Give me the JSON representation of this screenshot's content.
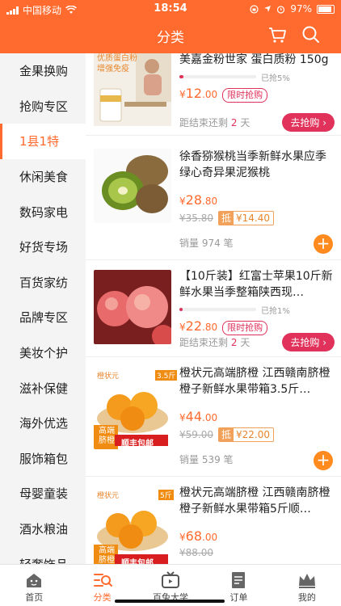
{
  "status_bar": {
    "carrier": "中国移动",
    "time": "18:54",
    "battery": "97%"
  },
  "header": {
    "title": "分类",
    "icons": [
      "cart-icon",
      "search-icon"
    ]
  },
  "sidebar": {
    "items": [
      {
        "label": "金果换购"
      },
      {
        "label": "抢购专区"
      },
      {
        "label": "1县1特",
        "active": true
      },
      {
        "label": "休闲美食"
      },
      {
        "label": "数码家电"
      },
      {
        "label": "好货专场"
      },
      {
        "label": "百货家纺"
      },
      {
        "label": "品牌专区"
      },
      {
        "label": "美妆个护"
      },
      {
        "label": "滋补保健"
      },
      {
        "label": "海外优选"
      },
      {
        "label": "服饰箱包"
      },
      {
        "label": "母婴童装"
      },
      {
        "label": "酒水粮油"
      },
      {
        "label": "轻奢饰品"
      }
    ]
  },
  "products": [
    {
      "name": "美嘉金粉世家 蛋白质粉 150g",
      "type": "flash",
      "progress_label": "已抢5%",
      "progress": 0.05,
      "price_symbol": "¥",
      "price_int": "12",
      "price_dec": ".00",
      "tag": "限时抢购",
      "countdown_prefix": "距结束还剩",
      "countdown_days": "2",
      "countdown_unit": "天",
      "button": "去抢购",
      "image_text": {
        "line1": "优质蛋白粉",
        "line2": "增强免疫"
      }
    },
    {
      "name": "徐香猕猴桃当季新鲜水果应季绿心奇异果泥猴桃",
      "type": "normal",
      "price_symbol": "¥",
      "price_int": "28",
      "price_dec": ".80",
      "original_price": "¥35.80",
      "offset_label": "抵",
      "offset_value": "¥14.40",
      "sales": "销量 974 笔"
    },
    {
      "name": "【10斤装】红富士苹果10斤新鲜水果当季整箱陕西现…",
      "type": "flash",
      "progress_label": "已抢1%",
      "progress": 0.01,
      "price_symbol": "¥",
      "price_int": "22",
      "price_dec": ".80",
      "tag": "限时抢购",
      "countdown_prefix": "距结束还剩",
      "countdown_days": "2",
      "countdown_unit": "天",
      "button": "去抢购"
    },
    {
      "name": "橙状元高端脐橙 江西赣南脐橙橙子新鲜水果带箱3.5斤…",
      "type": "normal",
      "price_symbol": "¥",
      "price_int": "44",
      "price_dec": ".00",
      "original_price": "¥59.00",
      "offset_label": "抵",
      "offset_value": "¥22.00",
      "sales": "销量 539 笔",
      "image_text": {
        "brand": "橙状元",
        "weight": "3.5斤",
        "line1": "高端",
        "line2": "脐橙",
        "banner": "顺丰包邮"
      }
    },
    {
      "name": "橙状元高端脐橙 江西赣南脐橙橙子新鲜水果带箱5斤顺…",
      "type": "normal",
      "price_symbol": "¥",
      "price_int": "68",
      "price_dec": ".00",
      "original_price": "¥88.00",
      "image_text": {
        "brand": "橙状元",
        "weight": "5斤",
        "line1": "高端",
        "line2": "脐橙",
        "banner": "顺丰包邮"
      }
    }
  ],
  "tabbar": {
    "items": [
      {
        "label": "首页",
        "icon": "home-icon"
      },
      {
        "label": "分类",
        "icon": "category-icon",
        "active": true
      },
      {
        "label": "百兔大学",
        "icon": "tv-icon"
      },
      {
        "label": "订单",
        "icon": "order-icon"
      },
      {
        "label": "我的",
        "icon": "crown-icon"
      }
    ]
  },
  "colors": {
    "brand": "#ff6a2e",
    "accent": "#e0325a",
    "add_button": "#ff8a1e"
  }
}
